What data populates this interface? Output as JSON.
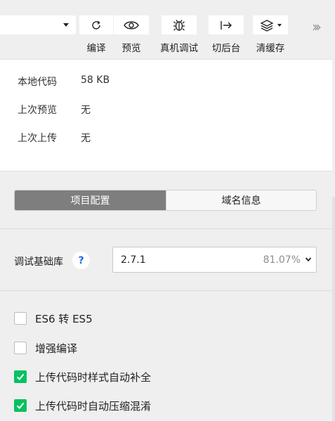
{
  "toolbar": {
    "compile_label": "编译",
    "preview_label": "预览",
    "real_device_label": "真机调试",
    "background_label": "切后台",
    "clear_cache_label": "清缓存"
  },
  "info": {
    "rows": [
      {
        "key": "本地代码",
        "value": "58 KB"
      },
      {
        "key": "上次预览",
        "value": "无"
      },
      {
        "key": "上次上传",
        "value": "无"
      }
    ]
  },
  "tabs": [
    {
      "label": "项目配置",
      "active": true
    },
    {
      "label": "域名信息",
      "active": false
    }
  ],
  "base_library": {
    "label": "调试基础库",
    "help": "?",
    "version": "2.7.1",
    "coverage": "81.07%"
  },
  "options": [
    {
      "label": "ES6 转 ES5",
      "checked": false
    },
    {
      "label": "增强编译",
      "checked": false
    },
    {
      "label": "上传代码时样式自动补全",
      "checked": true
    },
    {
      "label": "上传代码时自动压缩混淆",
      "checked": true
    }
  ],
  "colors": {
    "accent_green": "#07c160",
    "help_blue": "#1a6cdd",
    "active_tab": "#7e7e7e"
  }
}
